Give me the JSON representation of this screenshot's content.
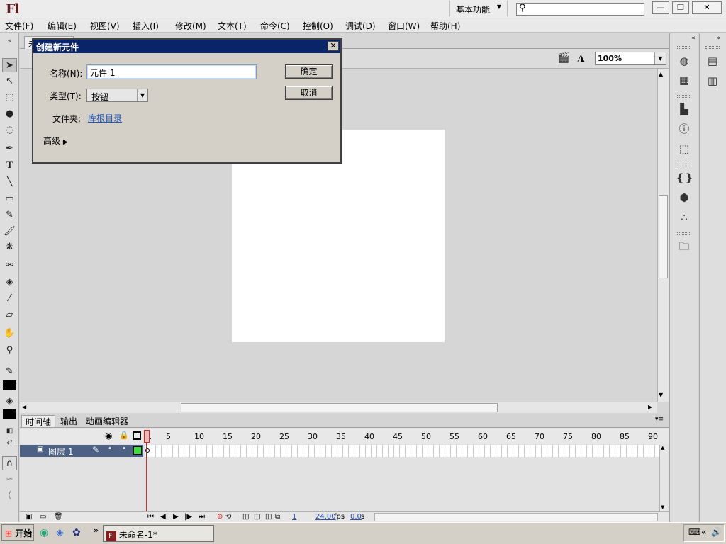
{
  "app": {
    "logo": "Fl"
  },
  "titlebar": {
    "workspace": "基本功能",
    "search_placeholder": ""
  },
  "window_controls": {
    "minimize": "—",
    "restore": "❐",
    "close": "✕"
  },
  "menu": [
    "文件(F)",
    "编辑(E)",
    "视图(V)",
    "插入(I)",
    "修改(M)",
    "文本(T)",
    "命令(C)",
    "控制(O)",
    "调试(D)",
    "窗口(W)",
    "帮助(H)"
  ],
  "stage": {
    "zoom": "100%",
    "doc_tab": "未"
  },
  "timeline": {
    "tabs": [
      "时间轴",
      "输出",
      "动画编辑器"
    ],
    "frame_numbers": [
      "1",
      "5",
      "10",
      "15",
      "20",
      "25",
      "30",
      "35",
      "40",
      "45",
      "50",
      "55",
      "60",
      "65",
      "70",
      "75",
      "80",
      "85",
      "90"
    ],
    "layer_name": "图层 1",
    "current_frame": "1",
    "fps": "24.00",
    "fps_unit": "fps",
    "elapsed": "0.0",
    "elapsed_unit": "s"
  },
  "dialog": {
    "title": "创建新元件",
    "name_label": "名称(N):",
    "name_value": "元件 1",
    "type_label": "类型(T):",
    "type_value": "按钮",
    "folder_label": "文件夹:",
    "folder_value": "库根目录",
    "advanced_label": "高级",
    "ok_button": "确定",
    "cancel_button": "取消"
  },
  "taskbar": {
    "start": "开始",
    "task_title": "未命名-1*"
  },
  "colors": {
    "dialog_title_bg": "#0a246a",
    "layer_selected": "#4d6185",
    "playhead": "#dd2222"
  }
}
